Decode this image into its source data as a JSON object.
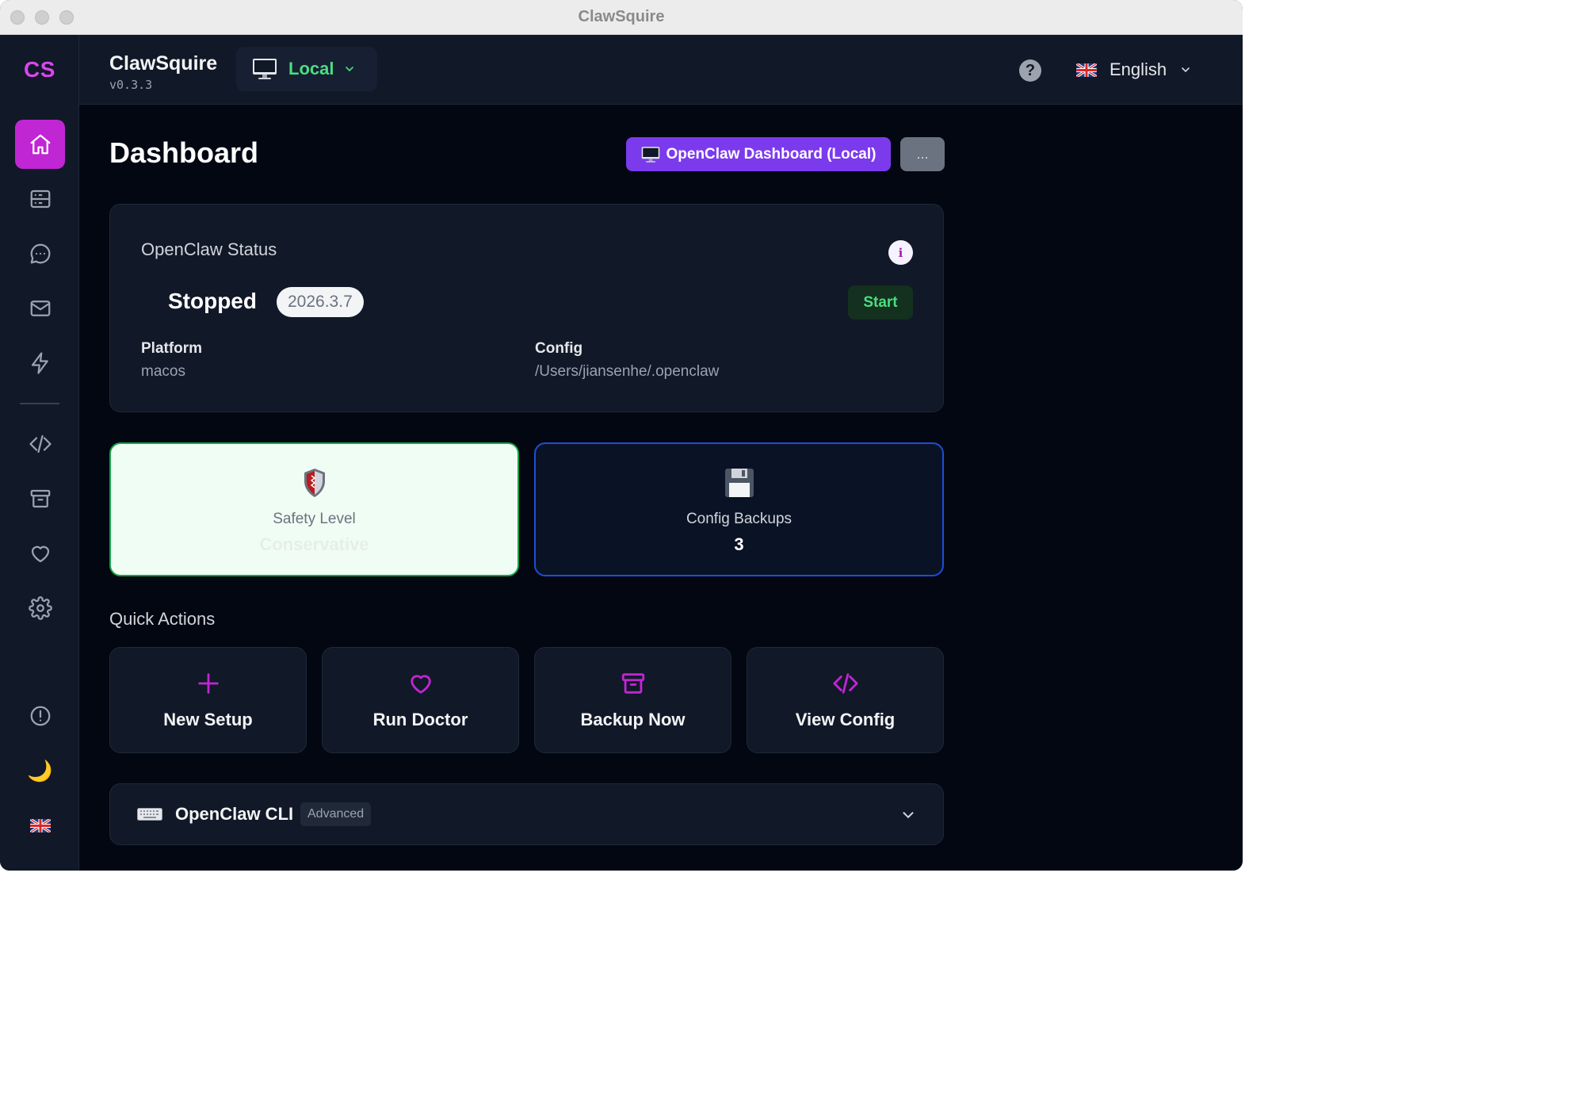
{
  "window": {
    "title": "ClawSquire"
  },
  "sidebar": {
    "logo": "CS",
    "items": [
      {
        "name": "home",
        "icon": "home-icon",
        "active": true
      },
      {
        "name": "servers",
        "icon": "server-icon"
      },
      {
        "name": "chat",
        "icon": "chat-icon"
      },
      {
        "name": "mail",
        "icon": "mail-icon"
      },
      {
        "name": "actions",
        "icon": "bolt-icon"
      },
      {
        "name": "config",
        "icon": "code-icon"
      },
      {
        "name": "backups",
        "icon": "archive-icon"
      },
      {
        "name": "doctor",
        "icon": "heart-icon"
      },
      {
        "name": "settings",
        "icon": "gear-icon"
      }
    ],
    "bottom_items": [
      {
        "name": "alerts",
        "icon": "alert-circle-icon"
      },
      {
        "name": "theme",
        "icon": "moon-icon",
        "glyph": "🌙"
      },
      {
        "name": "language",
        "icon": "uk-flag-icon"
      }
    ]
  },
  "header": {
    "app_name": "ClawSquire",
    "version": "v0.3.3",
    "environment": {
      "label": "Local",
      "icon": "monitor-icon",
      "color": "#4ade80"
    },
    "help_label": "?",
    "language": {
      "label": "English",
      "icon": "uk-flag-icon"
    }
  },
  "main": {
    "title": "Dashboard",
    "primary_button": {
      "label": "OpenClaw Dashboard (Local)",
      "icon": "monitor-icon"
    },
    "more_button": {
      "label": "..."
    },
    "status": {
      "heading": "OpenClaw Status",
      "info_label": "i",
      "state": "Stopped",
      "version": "2026.3.7",
      "start_label": "Start",
      "platform_label": "Platform",
      "platform_value": "macos",
      "config_label": "Config",
      "config_value": "/Users/jiansenhe/.openclaw"
    },
    "stats": {
      "safety": {
        "label": "Safety Level",
        "value": "Conservative",
        "icon": "shield-icon"
      },
      "backups": {
        "label": "Config Backups",
        "value": "3",
        "icon": "floppy-disk-icon"
      }
    },
    "quick_actions": {
      "title": "Quick Actions",
      "items": [
        {
          "label": "New Setup",
          "icon": "plus-icon"
        },
        {
          "label": "Run Doctor",
          "icon": "heart-icon"
        },
        {
          "label": "Backup Now",
          "icon": "archive-icon"
        },
        {
          "label": "View Config",
          "icon": "code-icon"
        }
      ]
    },
    "cli": {
      "title": "OpenClaw CLI",
      "badge": "Advanced",
      "icon": "keyboard-icon"
    }
  },
  "colors": {
    "accent": "#c026d3",
    "primary": "#7c3aed",
    "success": "#4ade80",
    "background": "#030712",
    "panel": "#111827"
  }
}
